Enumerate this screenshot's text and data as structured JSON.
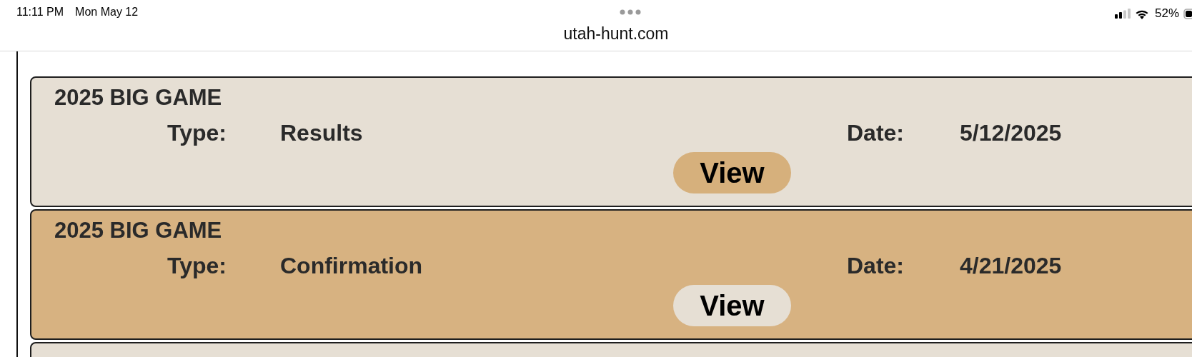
{
  "status_bar": {
    "time": "11:11 PM",
    "date": "Mon May 12",
    "battery": "52%"
  },
  "address_bar": {
    "url": "utah-hunt.com"
  },
  "cards": [
    {
      "kind": "light",
      "title": "2025 BIG GAME",
      "type_label": "Type:",
      "type_value": "Results",
      "date_label": "Date:",
      "date_value": "5/12/2025",
      "button": "View"
    },
    {
      "kind": "tan",
      "title": "2025 BIG GAME",
      "type_label": "Type:",
      "type_value": "Confirmation",
      "date_label": "Date:",
      "date_value": "4/21/2025",
      "button": "View"
    },
    {
      "kind": "light"
    }
  ]
}
